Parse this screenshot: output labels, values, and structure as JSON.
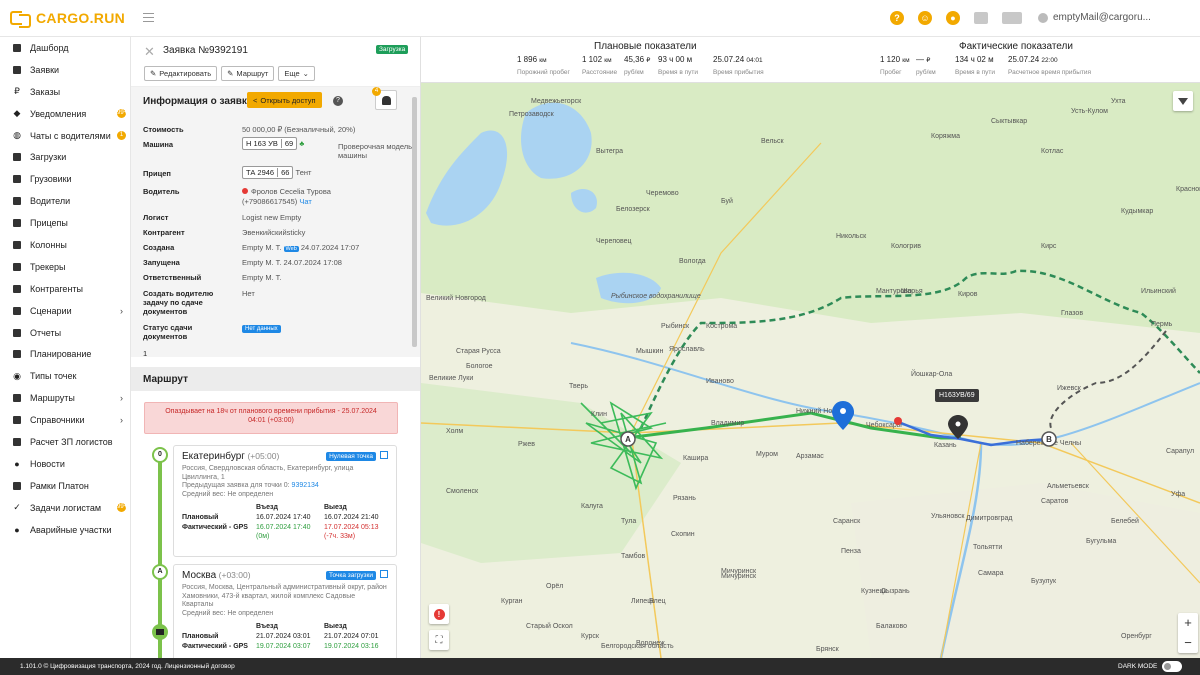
{
  "brand": {
    "name": "CARGO.RUN",
    "accent": "#f2a900"
  },
  "topbar": {
    "user": "emptyMail@cargoru...",
    "icons": [
      "help-icon",
      "chat-icon",
      "notification-icon",
      "document-icon",
      "truck-icon"
    ],
    "help_glyph": "?",
    "chat_glyph": "☺",
    "notif_glyph": "●"
  },
  "sidebar": {
    "items": [
      {
        "label": "Дашборд",
        "icon": "dashboard-icon"
      },
      {
        "label": "Заявки",
        "icon": "orders-icon"
      },
      {
        "label": "Заказы",
        "icon": "ruble-icon"
      },
      {
        "label": "Уведомления",
        "icon": "bell-icon",
        "badge": "99+"
      },
      {
        "label": "Чаты с водителями",
        "icon": "chat-icon",
        "badge": "1"
      },
      {
        "label": "Загрузки",
        "icon": "loading-icon"
      },
      {
        "label": "Грузовики",
        "icon": "truck-icon"
      },
      {
        "label": "Водители",
        "icon": "steering-wheel-icon"
      },
      {
        "label": "Прицепы",
        "icon": "trailer-icon"
      },
      {
        "label": "Колонны",
        "icon": "column-icon"
      },
      {
        "label": "Трекеры",
        "icon": "tracker-icon"
      },
      {
        "label": "Контрагенты",
        "icon": "contractor-icon"
      },
      {
        "label": "Сценарии",
        "icon": "scenario-icon",
        "chevron": "›"
      },
      {
        "label": "Отчеты",
        "icon": "reports-icon"
      },
      {
        "label": "Планирование",
        "icon": "planning-icon"
      },
      {
        "label": "Типы точек",
        "icon": "pin-icon"
      },
      {
        "label": "Маршруты",
        "icon": "routes-icon",
        "chevron": "›"
      },
      {
        "label": "Справочники",
        "icon": "directory-icon",
        "chevron": "›"
      },
      {
        "label": "Расчет ЗП логистов",
        "icon": "calculator-icon"
      },
      {
        "label": "Новости",
        "icon": "news-icon"
      },
      {
        "label": "Рамки Платон",
        "icon": "frame-icon"
      },
      {
        "label": "Задачи логистам",
        "icon": "check-icon",
        "badge": "99+"
      },
      {
        "label": "Аварийные участки",
        "icon": "alert-icon"
      }
    ]
  },
  "order": {
    "title": "Заявка №9392191",
    "status": "Загрузка",
    "buttons": {
      "edit": "Редактировать",
      "route": "Маршрут",
      "more": "Еще"
    },
    "info_title": "Информация о заявке",
    "access_button": "Открыть доступ",
    "help_glyph": "?",
    "bell_count": "4",
    "fields": {
      "cost_label": "Стоимость",
      "cost": "50 000,00 ₽ (Безналичный, 20%)",
      "truck_label": "Машина",
      "truck_plate": "Н 163 УВ",
      "truck_region": "69",
      "truck_check": "Проверочная модель машины",
      "trailer_label": "Прицеп",
      "trailer_plate": "ТА 2946",
      "trailer_region": "66",
      "trailer_type": "Тент",
      "driver_label": "Водитель",
      "driver_name": "Фролов Cecelia Турова",
      "driver_phone": "(+79086617545)",
      "driver_chat": "Чат",
      "logist_label": "Логист",
      "logist": "Logist new Empty",
      "contractor_label": "Контрагент",
      "contractor": "Эвенкийскийsticky",
      "created_label": "Создана",
      "created_by": "Empty M. T.",
      "created_src": "Web",
      "created_at": "24.07.2024 17:07",
      "started_label": "Запущена",
      "started": "Empty M. T. 24.07.2024 17:08",
      "responsible_label": "Ответственный",
      "responsible": "Empty M. T.",
      "create_task_label": "Создать водителю задачу по сдаче документов",
      "create_task": "Нет",
      "doc_status_label": "Статус сдачи документов",
      "doc_status": "Нет данных",
      "doc_count": "1"
    },
    "route_title": "Маршрут",
    "late_notice": "Опаздывает на 18ч от планового времени прибытия - 25.07.2024 04:01 (+03:00)",
    "points": [
      {
        "marker": "0",
        "city": "Екатеринбург",
        "tz": "(+05:00)",
        "type": "Нулевая точка",
        "address": "Россия, Свердловская область, Екатеринбург, улица Цвиллинга, 1",
        "prev_label": "Предыдущая заявка для точки 0:",
        "prev_id": "9392134",
        "weight": "Средний вес: Не определен",
        "col_in": "Въезд",
        "col_out": "Выезд",
        "plan_label": "Плановый",
        "plan_in": "16.07.2024 17:40",
        "plan_out": "16.07.2024 21:40",
        "fact_label": "Фактический - GPS",
        "fact_in": "16.07.2024 17:40",
        "fact_in_diff": "(0м)",
        "fact_out": "17.07.2024 05:13",
        "fact_out_diff": "(-7ч. 33м)"
      },
      {
        "marker": "A",
        "city": "Москва",
        "tz": "(+03:00)",
        "type": "Точка загрузки",
        "address": "Россия, Москва, Центральный административный округ, район Хамовники, 473-й квартал, жилой комплекс Садовые Кварталы",
        "weight": "Средний вес: Не определен",
        "col_in": "Въезд",
        "col_out": "Выезд",
        "plan_label": "Плановый",
        "plan_in": "21.07.2024 03:01",
        "plan_out": "21.07.2024 07:01",
        "fact_label": "Фактический - GPS",
        "fact_in": "19.07.2024 03:07",
        "fact_out": "19.07.2024 03:16"
      }
    ]
  },
  "metrics": {
    "planned": {
      "title": "Плановые показатели",
      "empty_run": "1 896",
      "empty_run_unit": "км",
      "empty_run_label": "Порожний пробег",
      "distance": "1 102",
      "distance_unit": "км",
      "distance_label": "Расстояние",
      "rate": "45,36",
      "rate_unit": "₽",
      "rate_label": "руб/км",
      "travel": "93 ч 00 м",
      "travel_label": "Время в пути",
      "arrival": "25.07.24",
      "arrival_time": "04:01",
      "arrival_label": "Время прибытия"
    },
    "actual": {
      "title": "Фактические показатели",
      "run": "1 120",
      "run_unit": "км",
      "run_label": "Пробег",
      "rate": "—",
      "rate_unit": "₽",
      "rate_label": "руб/км",
      "travel": "134 ч 02 м",
      "travel_label": "Время в пути",
      "arrival": "25.07.24",
      "arrival_time": "22:00",
      "arrival_label": "Расчетное время прибытия"
    }
  },
  "map": {
    "vehicle_label": "Н163УВ/69",
    "marker_a": "A",
    "marker_b": "B",
    "zoom_in": "+",
    "zoom_out": "−",
    "warn_glyph": "!",
    "cities": [
      {
        "name": "Петрозаводск"
      },
      {
        "name": "Медвежьегорск"
      },
      {
        "name": "Сыктывкар"
      },
      {
        "name": "Котлас"
      },
      {
        "name": "Вологда"
      },
      {
        "name": "Череповец"
      },
      {
        "name": "Кострома"
      },
      {
        "name": "Ярославль"
      },
      {
        "name": "Рыбинск"
      },
      {
        "name": "Иваново"
      },
      {
        "name": "Киров"
      },
      {
        "name": "Пермь"
      },
      {
        "name": "Ижевск"
      },
      {
        "name": "Нижний Новгород"
      },
      {
        "name": "Чебоксары"
      },
      {
        "name": "Йошкар-Ола"
      },
      {
        "name": "Казань"
      },
      {
        "name": "Набережные Челны"
      },
      {
        "name": "Уфа"
      },
      {
        "name": "Ульяновск"
      },
      {
        "name": "Самара"
      },
      {
        "name": "Тольятти"
      },
      {
        "name": "Пенза"
      },
      {
        "name": "Саранск"
      },
      {
        "name": "Рязань"
      },
      {
        "name": "Тула"
      },
      {
        "name": "Калуга"
      },
      {
        "name": "Смоленск"
      },
      {
        "name": "Тверь"
      },
      {
        "name": "Великий Новгород"
      },
      {
        "name": "Тамбов"
      },
      {
        "name": "Липецк"
      },
      {
        "name": "Воронеж"
      },
      {
        "name": "Орёл"
      },
      {
        "name": "Курск"
      },
      {
        "name": "Брянск"
      },
      {
        "name": "Саратов"
      },
      {
        "name": "Оренбург"
      },
      {
        "name": "Альметьевск"
      },
      {
        "name": "Муром"
      },
      {
        "name": "Владимир"
      },
      {
        "name": "Клин"
      },
      {
        "name": "Ржев"
      },
      {
        "name": "Великие Луки"
      },
      {
        "name": "Глазов"
      },
      {
        "name": "Вытегра"
      },
      {
        "name": "Белозерск"
      },
      {
        "name": "Никольск"
      },
      {
        "name": "Шарья"
      },
      {
        "name": "Кирс"
      },
      {
        "name": "Кудымкар"
      },
      {
        "name": "Сарапул"
      },
      {
        "name": "Бугульма"
      },
      {
        "name": "Сызрань"
      },
      {
        "name": "Балаково"
      },
      {
        "name": "Мичуринск"
      },
      {
        "name": "Елец"
      },
      {
        "name": "Кашира"
      },
      {
        "name": "Скопин"
      },
      {
        "name": "Кузнецк"
      },
      {
        "name": "Димитровград"
      },
      {
        "name": "Бузулук"
      },
      {
        "name": "Белебей"
      },
      {
        "name": "Рыбинское водохранилище"
      },
      {
        "name": "Вельск"
      },
      {
        "name": "Коряжма"
      },
      {
        "name": "Ухта"
      },
      {
        "name": "Старая Русса"
      },
      {
        "name": "Холм"
      },
      {
        "name": "Бологое"
      },
      {
        "name": "Арзамас"
      },
      {
        "name": "Курган"
      },
      {
        "name": "Буй"
      },
      {
        "name": "Красновишерск"
      },
      {
        "name": "Ильинский"
      },
      {
        "name": "Усть-Кулом"
      },
      {
        "name": "Кологрив"
      },
      {
        "name": "Мантурово"
      },
      {
        "name": "Черемово"
      },
      {
        "name": "Мышкин"
      },
      {
        "name": "Белгородская область"
      },
      {
        "name": "Старый Оскол"
      },
      {
        "name": "Мичуринск"
      }
    ]
  },
  "footer": {
    "text": "1.101.0 © Цифровизация транспорта, 2024 год.  Лицензионный договор",
    "dark_mode": "DARK MODE"
  }
}
